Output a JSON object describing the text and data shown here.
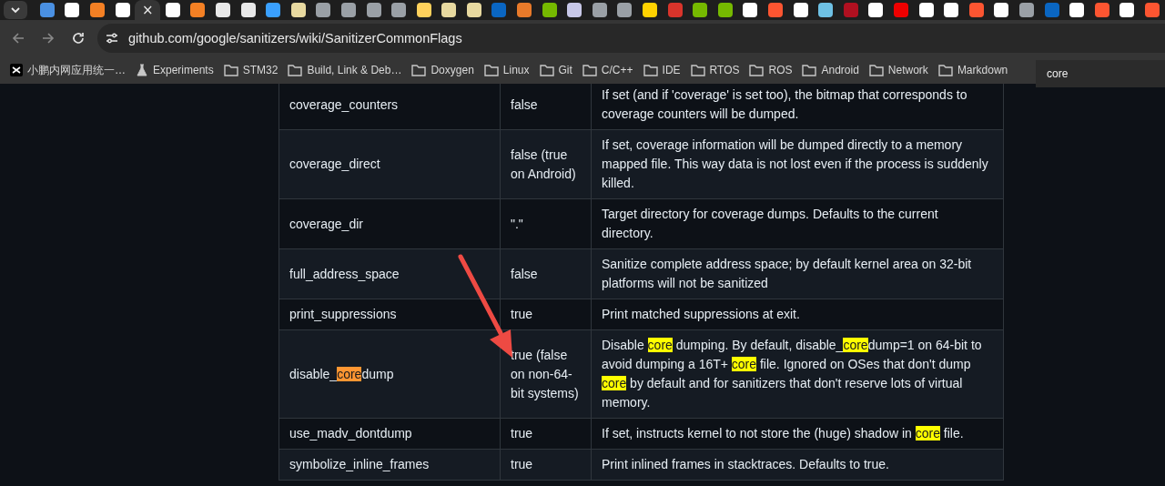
{
  "tab_strip": {
    "close_glyph": "×",
    "tabs": [
      {
        "selected": false,
        "color": "#4a90e2"
      },
      {
        "selected": false,
        "color": "#ffffff"
      },
      {
        "selected": false,
        "color": "#f48024"
      },
      {
        "selected": false,
        "color": "#ffffff"
      },
      {
        "selected": true
      },
      {
        "selected": false,
        "color": "#ffffff"
      },
      {
        "selected": false,
        "color": "#f48024"
      },
      {
        "selected": false,
        "color": "#e8e8e8"
      },
      {
        "selected": false,
        "color": "#e8e8e8"
      },
      {
        "selected": false,
        "color": "#3aa0ff"
      },
      {
        "selected": false,
        "color": "#e8d9a0"
      },
      {
        "selected": false,
        "color": "#9aa0a6"
      },
      {
        "selected": false,
        "color": "#9aa0a6"
      },
      {
        "selected": false,
        "color": "#9aa0a6"
      },
      {
        "selected": false,
        "color": "#9aa0a6"
      },
      {
        "selected": false,
        "color": "#ffd15c"
      },
      {
        "selected": false,
        "color": "#e8d9a0"
      },
      {
        "selected": false,
        "color": "#e8d9a0"
      },
      {
        "selected": false,
        "color": "#0a66c2"
      },
      {
        "selected": false,
        "color": "#e87a2a"
      },
      {
        "selected": false,
        "color": "#76b900"
      },
      {
        "selected": false,
        "color": "#c8c8e8"
      },
      {
        "selected": false,
        "color": "#9aa0a6"
      },
      {
        "selected": false,
        "color": "#9aa0a6"
      },
      {
        "selected": false,
        "color": "#ffd200"
      },
      {
        "selected": false,
        "color": "#d9342b"
      },
      {
        "selected": false,
        "color": "#76b900"
      },
      {
        "selected": false,
        "color": "#76b900"
      },
      {
        "selected": false,
        "color": "#ffffff"
      },
      {
        "selected": false,
        "color": "#fc5531"
      },
      {
        "selected": false,
        "color": "#ffffff"
      },
      {
        "selected": false,
        "color": "#6ec1e4"
      },
      {
        "selected": false,
        "color": "#b01020"
      },
      {
        "selected": false,
        "color": "#ffffff"
      },
      {
        "selected": false,
        "color": "#ee0000"
      },
      {
        "selected": false,
        "color": "#ffffff"
      },
      {
        "selected": false,
        "color": "#ffffff"
      },
      {
        "selected": false,
        "color": "#fc5531"
      },
      {
        "selected": false,
        "color": "#ffffff"
      },
      {
        "selected": false,
        "color": "#9aa0a6"
      },
      {
        "selected": false,
        "color": "#0a66c2"
      },
      {
        "selected": false,
        "color": "#ffffff"
      },
      {
        "selected": false,
        "color": "#fc5531"
      },
      {
        "selected": false,
        "color": "#ffffff"
      },
      {
        "selected": false,
        "color": "#fc5531"
      }
    ]
  },
  "toolbar": {
    "back_disabled": true,
    "forward_disabled": true,
    "address": "github.com/google/sanitizers/wiki/SanitizerCommonFlags"
  },
  "bookmarks": [
    {
      "kind": "app",
      "label": "小鹏内网应用统一…"
    },
    {
      "kind": "flask",
      "label": "Experiments"
    },
    {
      "kind": "folder",
      "label": "STM32"
    },
    {
      "kind": "folder",
      "label": "Build, Link & Deb…"
    },
    {
      "kind": "folder",
      "label": "Doxygen"
    },
    {
      "kind": "folder",
      "label": "Linux"
    },
    {
      "kind": "folder",
      "label": "Git"
    },
    {
      "kind": "folder",
      "label": "C/C++"
    },
    {
      "kind": "folder",
      "label": "IDE"
    },
    {
      "kind": "folder",
      "label": "RTOS"
    },
    {
      "kind": "folder",
      "label": "ROS"
    },
    {
      "kind": "folder",
      "label": "Android"
    },
    {
      "kind": "folder",
      "label": "Network"
    },
    {
      "kind": "folder",
      "label": "Markdown"
    }
  ],
  "find": {
    "value": "core"
  },
  "table": {
    "rows": [
      {
        "flag": "coverage_counters",
        "default": "false",
        "description": "If set (and if 'coverage' is set too), the bitmap that corresponds to coverage counters will be dumped."
      },
      {
        "flag": "coverage_direct",
        "default": "false (true on Android)",
        "description": "If set, coverage information will be dumped directly to a memory mapped file. This way data is not lost even if the process is suddenly killed."
      },
      {
        "flag": "coverage_dir",
        "default": "\".\"",
        "description": "Target directory for coverage dumps. Defaults to the current directory."
      },
      {
        "flag": "full_address_space",
        "default": "false",
        "description": "Sanitize complete address space; by default kernel area on 32-bit platforms will not be sanitized"
      },
      {
        "flag": "print_suppressions",
        "default": "true",
        "description": "Print matched suppressions at exit."
      },
      {
        "flag": [
          "disable_",
          {
            "text": "core",
            "current": true
          },
          "dump"
        ],
        "default": "true (false on non-64-bit systems)",
        "description": [
          "Disable ",
          {
            "text": "core",
            "current": false
          },
          " dumping. By default, disable_",
          {
            "text": "core",
            "current": false
          },
          "dump=1 on 64-bit to avoid dumping a 16T+ ",
          {
            "text": "core",
            "current": false
          },
          " file. Ignored on OSes that don't dump ",
          {
            "text": "core",
            "current": false
          },
          " by default and for sanitizers that don't reserve lots of virtual memory."
        ]
      },
      {
        "flag": "use_madv_dontdump",
        "default": "true",
        "description": [
          "If set, instructs kernel to not store the (huge) shadow in ",
          {
            "text": "core",
            "current": false
          },
          " file."
        ]
      },
      {
        "flag": "symbolize_inline_frames",
        "default": "true",
        "description": "Print inlined frames in stacktraces. Defaults to true."
      }
    ]
  }
}
